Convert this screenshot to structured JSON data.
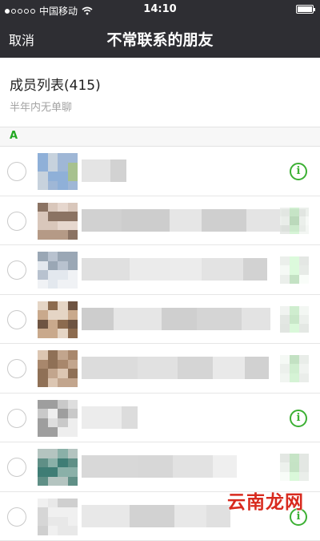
{
  "status_bar": {
    "carrier": "中国移动",
    "time": "14:10",
    "signal_filled": 1,
    "signal_total": 5
  },
  "nav": {
    "cancel_label": "取消",
    "title": "不常联系的朋友"
  },
  "header": {
    "title": "成员列表(415)",
    "subtitle": "半年内无单聊"
  },
  "section": {
    "letter": "A"
  },
  "colors": {
    "accent_green": "#3cb034",
    "nav_bg": "#2e2e33",
    "watermark_red": "#d82a1e"
  },
  "rows": [
    {
      "info_icon": "info-icon",
      "info_visible": true
    },
    {
      "info_icon": "info-icon",
      "info_visible": false
    },
    {
      "info_icon": "info-icon",
      "info_visible": false
    },
    {
      "info_icon": "info-icon",
      "info_visible": false
    },
    {
      "info_icon": "info-icon",
      "info_visible": false
    },
    {
      "info_icon": "info-icon",
      "info_visible": true
    },
    {
      "info_icon": "info-icon",
      "info_visible": false
    },
    {
      "info_icon": "info-icon",
      "info_visible": true
    }
  ],
  "watermark": "云南龙网"
}
